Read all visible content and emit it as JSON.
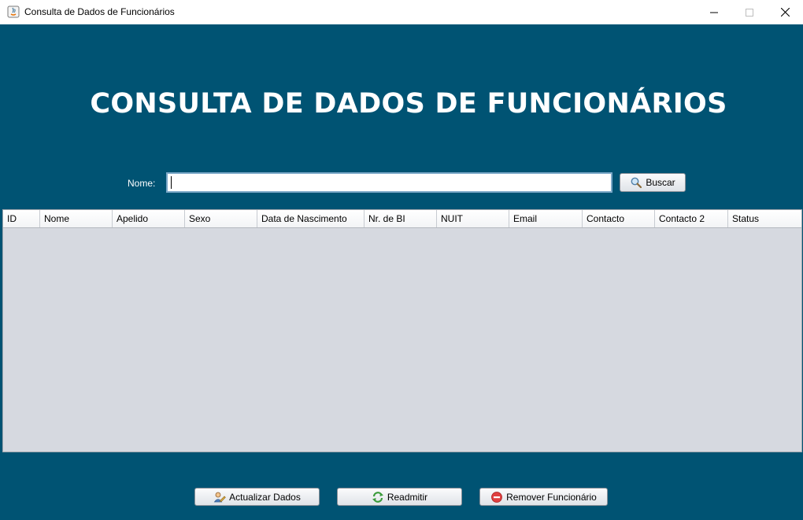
{
  "window": {
    "title": "Consulta de Dados de Funcionários"
  },
  "header": {
    "title": "CONSULTA DE DADOS DE FUNCIONÁRIOS"
  },
  "search": {
    "label": "Nome:",
    "value": "",
    "button_label": "Buscar",
    "button_icon": "magnifier-icon"
  },
  "table": {
    "columns": [
      "ID",
      "Nome",
      "Apelido",
      "Sexo",
      "Data de Nascimento",
      "Nr. de BI",
      "NUIT",
      "Email",
      "Contacto",
      "Contacto 2",
      "Status"
    ],
    "rows": []
  },
  "actions": {
    "update_label": "Actualizar Dados",
    "readmit_label": "Readmitir",
    "remove_label": "Remover Funcionário"
  },
  "colors": {
    "background": "#005373",
    "table_body": "#d6d9e0",
    "heading_text": "#ffffff"
  }
}
